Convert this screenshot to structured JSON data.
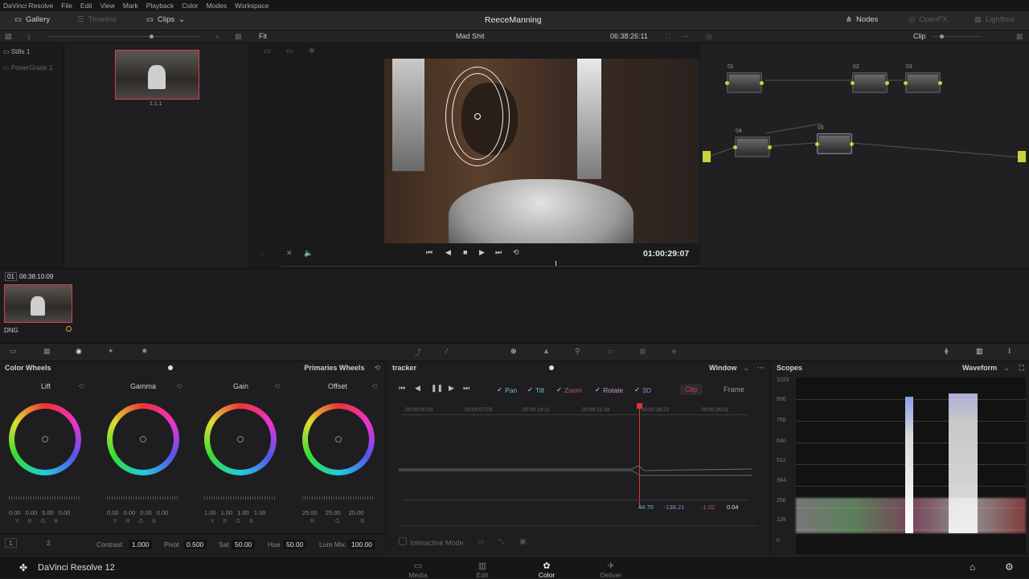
{
  "menubar": [
    "DaVinci Resolve",
    "File",
    "Edit",
    "View",
    "Mark",
    "Playback",
    "Color",
    "Modes",
    "Workspace"
  ],
  "topbar": {
    "gallery": "Gallery",
    "timeline": "Timeline",
    "clips": "Clips",
    "project": "ReeceManning",
    "nodes": "Nodes",
    "lightbox": "Lightbox",
    "openfx": "OpenFX"
  },
  "toolbar2": {
    "fit": "Fit",
    "clip_name": "Mad Shit",
    "timecode": "06:38:26:11",
    "mode": "Clip"
  },
  "gallery": {
    "albums": [
      "Stills 1",
      "PowerGrade 1"
    ],
    "still_label": "1.1.1"
  },
  "viewer": {
    "timecode": "01:00:29:07"
  },
  "nodes": {
    "labels": [
      "01",
      "02",
      "03",
      "04",
      "05"
    ]
  },
  "clip": {
    "index": "01",
    "timecode": "06:38:10:09",
    "format": "DNG"
  },
  "color_wheels": {
    "title": "Color Wheels",
    "mode": "Primaries Wheels",
    "wheels": [
      {
        "name": "Lift",
        "values": [
          "0.00",
          "0.00",
          "0.00",
          "0.00"
        ]
      },
      {
        "name": "Gamma",
        "values": [
          "0.00",
          "0.00",
          "0.00",
          "0.00"
        ]
      },
      {
        "name": "Gain",
        "values": [
          "1.00",
          "1.00",
          "1.00",
          "1.00"
        ]
      },
      {
        "name": "Offset",
        "values": [
          "25.00",
          "25.00",
          "25.00"
        ]
      }
    ],
    "channel_labels_4": [
      "Y",
      "R",
      "G",
      "B"
    ],
    "channel_labels_3": [
      "R",
      "G",
      "B"
    ]
  },
  "bottom": {
    "page": "2",
    "contrast_label": "Contrast",
    "contrast": "1.000",
    "pivot_label": "Pivot",
    "pivot": "0.500",
    "sat_label": "Sat",
    "sat": "50.00",
    "hue_label": "Hue",
    "hue": "50.00",
    "lummix_label": "Lum Mix",
    "lummix": "100.00"
  },
  "tracker": {
    "title": "tracker",
    "window": "Window",
    "checks": [
      "Pan",
      "Tilt",
      "Zoom",
      "Rotate",
      "3D"
    ],
    "clip_btn": "Clip",
    "frame_btn": "Frame",
    "ticks": [
      "00:00:00:00",
      "00:00:07:03",
      "00:00:14:11",
      "00:00:21:18",
      "00:00:28:22",
      "00:00:36:02"
    ],
    "readout": [
      "44.70",
      "-138.21",
      "-1.02",
      "0.04"
    ],
    "interactive": "Interactive Mode"
  },
  "scopes": {
    "title": "Scopes",
    "mode": "Waveform",
    "scale": [
      "1023",
      "896",
      "768",
      "640",
      "512",
      "384",
      "256",
      "128",
      "0"
    ]
  },
  "taskbar": {
    "app": "DaVinci Resolve 12",
    "tabs": [
      "Media",
      "Edit",
      "Color",
      "Deliver"
    ]
  }
}
